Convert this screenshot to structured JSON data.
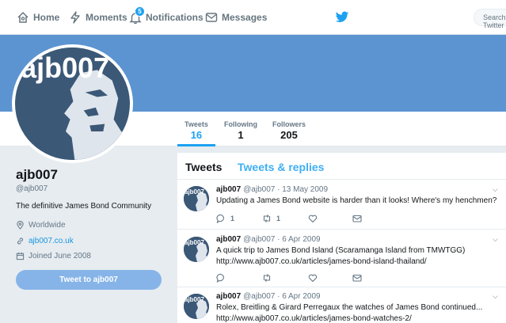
{
  "nav": {
    "home": "Home",
    "moments": "Moments",
    "notifications": "Notifications",
    "notification_count": "5",
    "messages": "Messages",
    "search_placeholder": "Search Twitter"
  },
  "colors": {
    "accent": "#1da1f2",
    "banner": "#5c94d1",
    "button": "#86b4e8"
  },
  "profile": {
    "avatar_text": "ajb007",
    "name": "ajb007",
    "handle": "@ajb007",
    "bio": "The definitive James Bond Community",
    "location": "Worldwide",
    "url": "ajb007.co.uk",
    "joined": "Joined June 2008",
    "tweet_to_label": "Tweet to ajb007"
  },
  "stats": {
    "tweets_label": "Tweets",
    "tweets_value": "16",
    "following_label": "Following",
    "following_value": "1",
    "followers_label": "Followers",
    "followers_value": "205"
  },
  "timeline": {
    "tabs": [
      "Tweets",
      "Tweets & replies"
    ],
    "tweets": [
      {
        "name": "ajb007",
        "meta": "@ajb007 · 13 May 2009",
        "lines": [
          "Updating a James Bond website is harder than it looks! Where's my henchmen?!"
        ],
        "replies": "1",
        "retweets": "1"
      },
      {
        "name": "ajb007",
        "meta": "@ajb007 · 6 Apr 2009",
        "lines": [
          "A quick trip to James Bond Island (Scaramanga Island from TMWTGG)",
          "http://www.ajb007.co.uk/articles/james-bond-island-thailand/"
        ],
        "replies": "",
        "retweets": ""
      },
      {
        "name": "ajb007",
        "meta": "@ajb007 · 6 Apr 2009",
        "lines": [
          "Rolex, Breitling & Girard Perregaux the watches of James Bond continued...",
          "http://www.ajb007.co.uk/articles/james-bond-watches-2/"
        ],
        "replies": "",
        "retweets": ""
      }
    ]
  }
}
